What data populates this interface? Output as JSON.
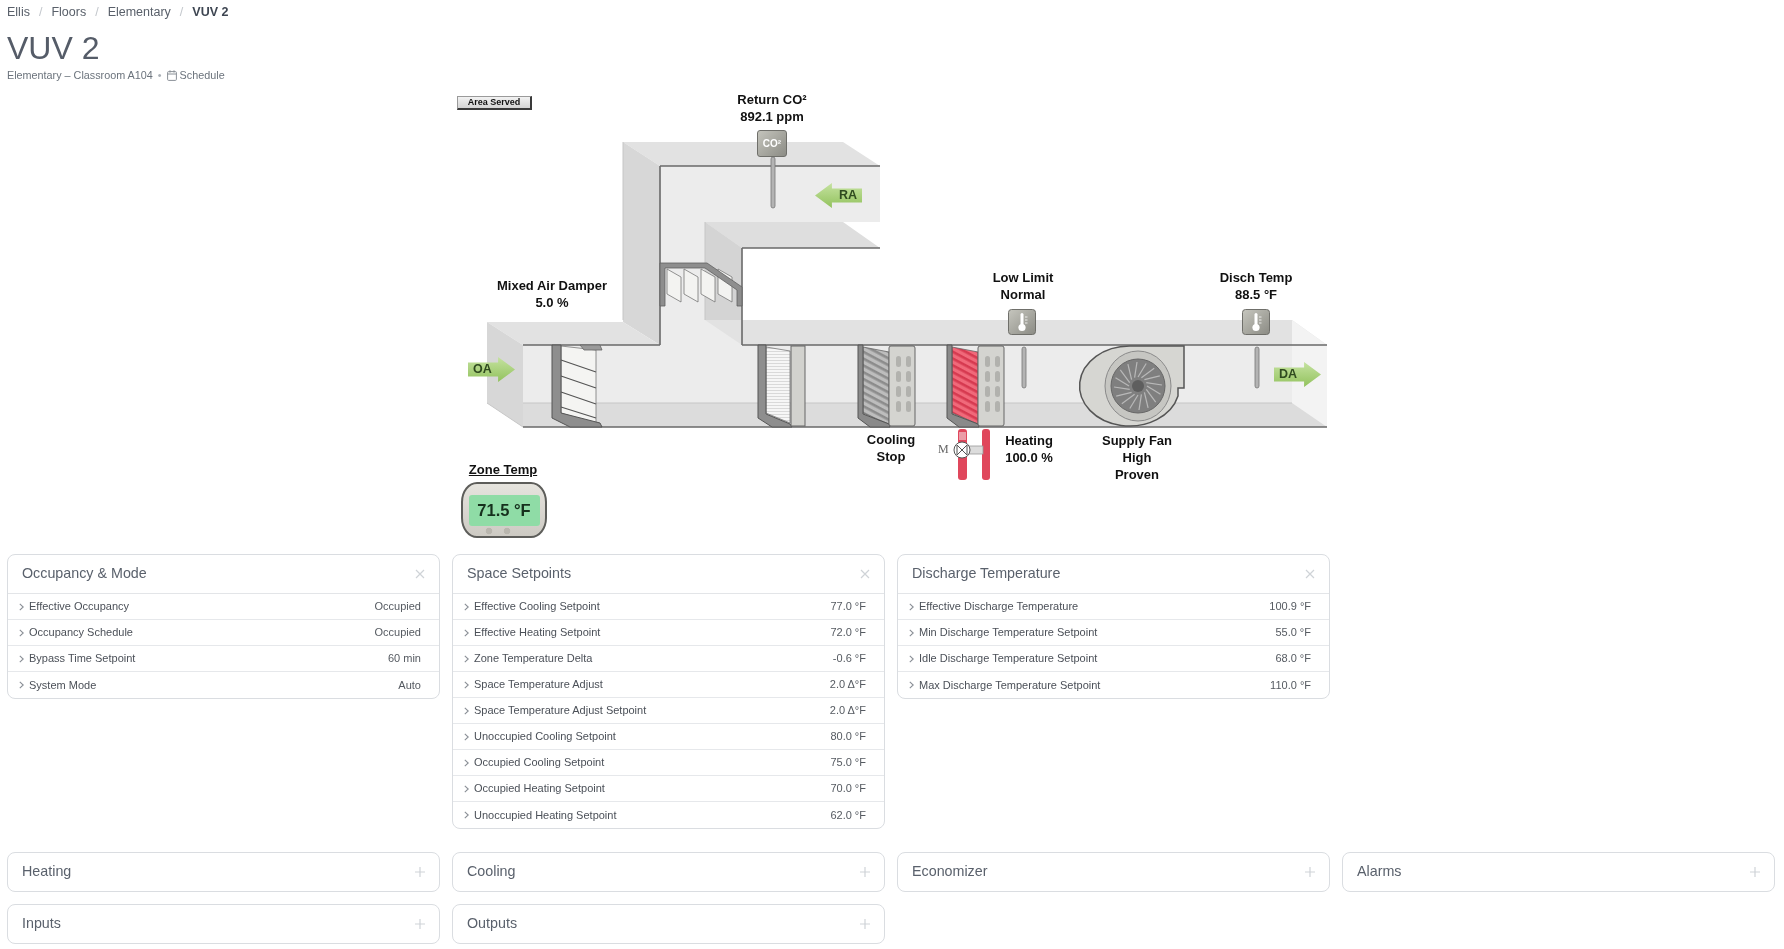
{
  "breadcrumb": {
    "separator": "/",
    "items": [
      {
        "label": "Ellis",
        "current": false
      },
      {
        "label": "Floors",
        "current": false
      },
      {
        "label": "Elementary",
        "current": false
      },
      {
        "label": "VUV 2",
        "current": true
      }
    ]
  },
  "title": "VUV 2",
  "subtitle": {
    "location": "Elementary – Classroom A104",
    "separator": "•",
    "schedule_link": "Schedule"
  },
  "diagram": {
    "area_served_button": "Area Served",
    "return_co2": {
      "label": "Return CO²",
      "value": "892.1 ppm",
      "sensor_text": "CO²"
    },
    "airflows": [
      {
        "label": "OA",
        "kind": "rightward"
      },
      {
        "label": "RA",
        "kind": "leftward"
      },
      {
        "label": "DA",
        "kind": "rightward"
      }
    ],
    "mixed_air_damper": {
      "label": "Mixed Air Damper",
      "value": "5.0 %"
    },
    "low_limit": {
      "label": "Low Limit",
      "value": "Normal"
    },
    "discharge_temp": {
      "label": "Disch Temp",
      "value": "88.5 °F"
    },
    "cooling": {
      "label": "Cooling",
      "value": "Stop",
      "active": false
    },
    "heating": {
      "label": "Heating",
      "value": "100.0 %",
      "active": true,
      "actuator_label": "M"
    },
    "supply_fan": {
      "label": "Supply Fan",
      "speed": "High",
      "status": "Proven"
    },
    "zone_temp": {
      "label": "Zone Temp",
      "value": "71.5 °F"
    }
  },
  "panel_groups": [
    {
      "panels": [
        {
          "title": "Occupancy & Mode",
          "expanded": true,
          "rows": [
            {
              "label": "Effective Occupancy",
              "value": "Occupied"
            },
            {
              "label": "Occupancy Schedule",
              "value": "Occupied"
            },
            {
              "label": "Bypass Time Setpoint",
              "value": "60 min"
            },
            {
              "label": "System Mode",
              "value": "Auto"
            }
          ]
        },
        {
          "title": "Space Setpoints",
          "expanded": true,
          "rows": [
            {
              "label": "Effective Cooling Setpoint",
              "value": "77.0 °F"
            },
            {
              "label": "Effective Heating Setpoint",
              "value": "72.0 °F"
            },
            {
              "label": "Zone Temperature Delta",
              "value": "-0.6 °F"
            },
            {
              "label": "Space Temperature Adjust",
              "value": "2.0 Δ°F"
            },
            {
              "label": "Space Temperature Adjust Setpoint",
              "value": "2.0 Δ°F"
            },
            {
              "label": "Unoccupied Cooling Setpoint",
              "value": "80.0 °F"
            },
            {
              "label": "Occupied Cooling Setpoint",
              "value": "75.0 °F"
            },
            {
              "label": "Occupied Heating Setpoint",
              "value": "70.0 °F"
            },
            {
              "label": "Unoccupied Heating Setpoint",
              "value": "62.0 °F"
            }
          ]
        },
        {
          "title": "Discharge Temperature",
          "expanded": true,
          "rows": [
            {
              "label": "Effective Discharge Temperature",
              "value": "100.9 °F"
            },
            {
              "label": "Min Discharge Temperature Setpoint",
              "value": "55.0 °F"
            },
            {
              "label": "Idle Discharge Temperature Setpoint",
              "value": "68.0 °F"
            },
            {
              "label": "Max Discharge Temperature Setpoint",
              "value": "110.0 °F"
            }
          ]
        }
      ]
    },
    {
      "panels": [
        {
          "title": "Heating",
          "expanded": false
        },
        {
          "title": "Cooling",
          "expanded": false
        },
        {
          "title": "Economizer",
          "expanded": false
        },
        {
          "title": "Alarms",
          "expanded": false
        },
        {
          "title": "Inputs",
          "expanded": false
        },
        {
          "title": "Outputs",
          "expanded": false
        }
      ]
    }
  ]
}
